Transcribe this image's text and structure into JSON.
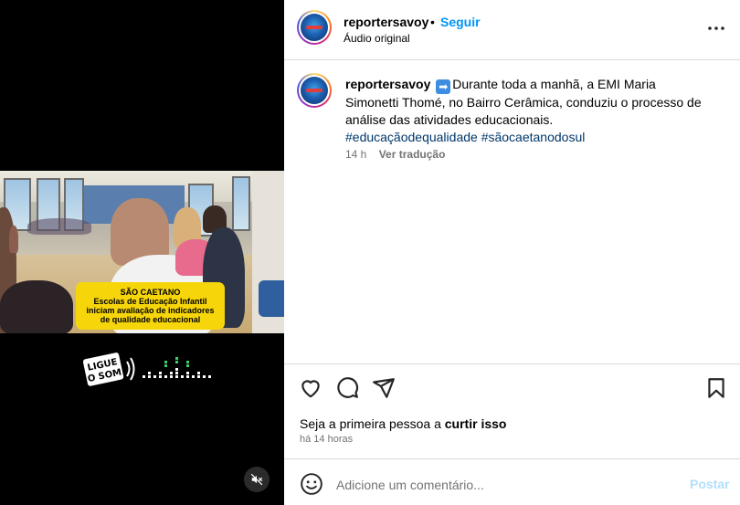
{
  "video": {
    "caption": {
      "title": "SÃO CAETANO",
      "line1": "Escolas de Educação Infantil",
      "line2": "iniciam avaliação de indicadores",
      "line3": "de qualidade educacional"
    },
    "ligue_badge": {
      "line1": "LIGUE",
      "line2": "O SOM"
    },
    "icons": {
      "mute": "speaker-muted-icon"
    }
  },
  "post_header": {
    "username": "reportersavoy",
    "separator": "•",
    "follow_label": "Seguir",
    "audio_label": "Áudio original",
    "more_icon": "more-options-icon"
  },
  "caption_comment": {
    "username": "reportersavoy",
    "arrow_emoji": "➡",
    "text": "Durante toda a manhã, a EMI Maria Simonetti Thomé, no Bairro Cerâmica, conduziu o processo de análise das atividades educacionais.",
    "hashtags": [
      "#educaçãodequalidade",
      "#sãocaetanodosul"
    ],
    "age": "14 h",
    "translate_label": "Ver tradução"
  },
  "actions": {
    "like_icon": "heart-icon",
    "comment_icon": "comment-icon",
    "share_icon": "send-icon",
    "save_icon": "bookmark-icon"
  },
  "likes": {
    "prefix": "Seja a primeira pessoa a ",
    "cta": "curtir isso"
  },
  "timestamp": "há 14 horas",
  "add_comment": {
    "emoji_icon": "emoji-icon",
    "placeholder": "Adicione um comentário...",
    "post_label": "Postar"
  },
  "colors": {
    "follow_blue": "#0095f6",
    "hashtag_blue": "#00376b",
    "muted_text": "#737373",
    "caption_yellow": "#f6d60b",
    "post_disabled": "#b2dffc"
  }
}
